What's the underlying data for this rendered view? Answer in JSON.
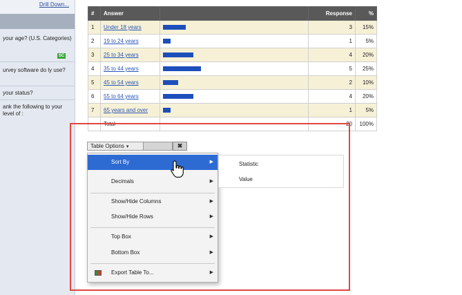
{
  "sidebar": {
    "drill_link": "Drill Down...",
    "items": [
      {
        "text": "your age? (U.S. Categories)"
      },
      {
        "text": "urvey software do ly use?"
      },
      {
        "text": "your status?"
      },
      {
        "text": "ank the following to your level of :"
      }
    ],
    "badge": "SC"
  },
  "table": {
    "headers": [
      "#",
      "Answer",
      "",
      "Response",
      "%"
    ],
    "rows": [
      {
        "num": "1",
        "answer": "Under 18 years",
        "response": "3",
        "pct": "15%",
        "share": 0.15
      },
      {
        "num": "2",
        "answer": "19 to 24 years",
        "response": "1",
        "pct": "5%",
        "share": 0.05
      },
      {
        "num": "3",
        "answer": "25 to 34 years",
        "response": "4",
        "pct": "20%",
        "share": 0.2
      },
      {
        "num": "4",
        "answer": "35 to 44 years",
        "response": "5",
        "pct": "25%",
        "share": 0.25
      },
      {
        "num": "5",
        "answer": "45 to 54 years",
        "response": "2",
        "pct": "10%",
        "share": 0.1
      },
      {
        "num": "6",
        "answer": "55 to 64 years",
        "response": "4",
        "pct": "20%",
        "share": 0.2
      },
      {
        "num": "7",
        "answer": "65 years and over",
        "response": "1",
        "pct": "5%",
        "share": 0.05
      }
    ],
    "total": {
      "label": "Total",
      "response": "20",
      "pct": "100%"
    },
    "bar_color": "#1d4fbb"
  },
  "table_options": {
    "label": "Table Options",
    "close_icon": "close-x-icon"
  },
  "menu": {
    "items": [
      {
        "label": "Sort By",
        "selected": true
      },
      {
        "label": "Decimals"
      },
      {
        "label": "Show/Hide Columns"
      },
      {
        "label": "Show/Hide Rows"
      },
      {
        "label": "Top Box"
      },
      {
        "label": "Bottom Box"
      },
      {
        "label": "Export Table To..."
      }
    ]
  },
  "submenu": {
    "items": [
      "Statistic",
      "Value"
    ]
  },
  "colors": {
    "highlight_box": "#e0463f",
    "menu_selected": "#2d6bd3",
    "link": "#2a55b8"
  }
}
